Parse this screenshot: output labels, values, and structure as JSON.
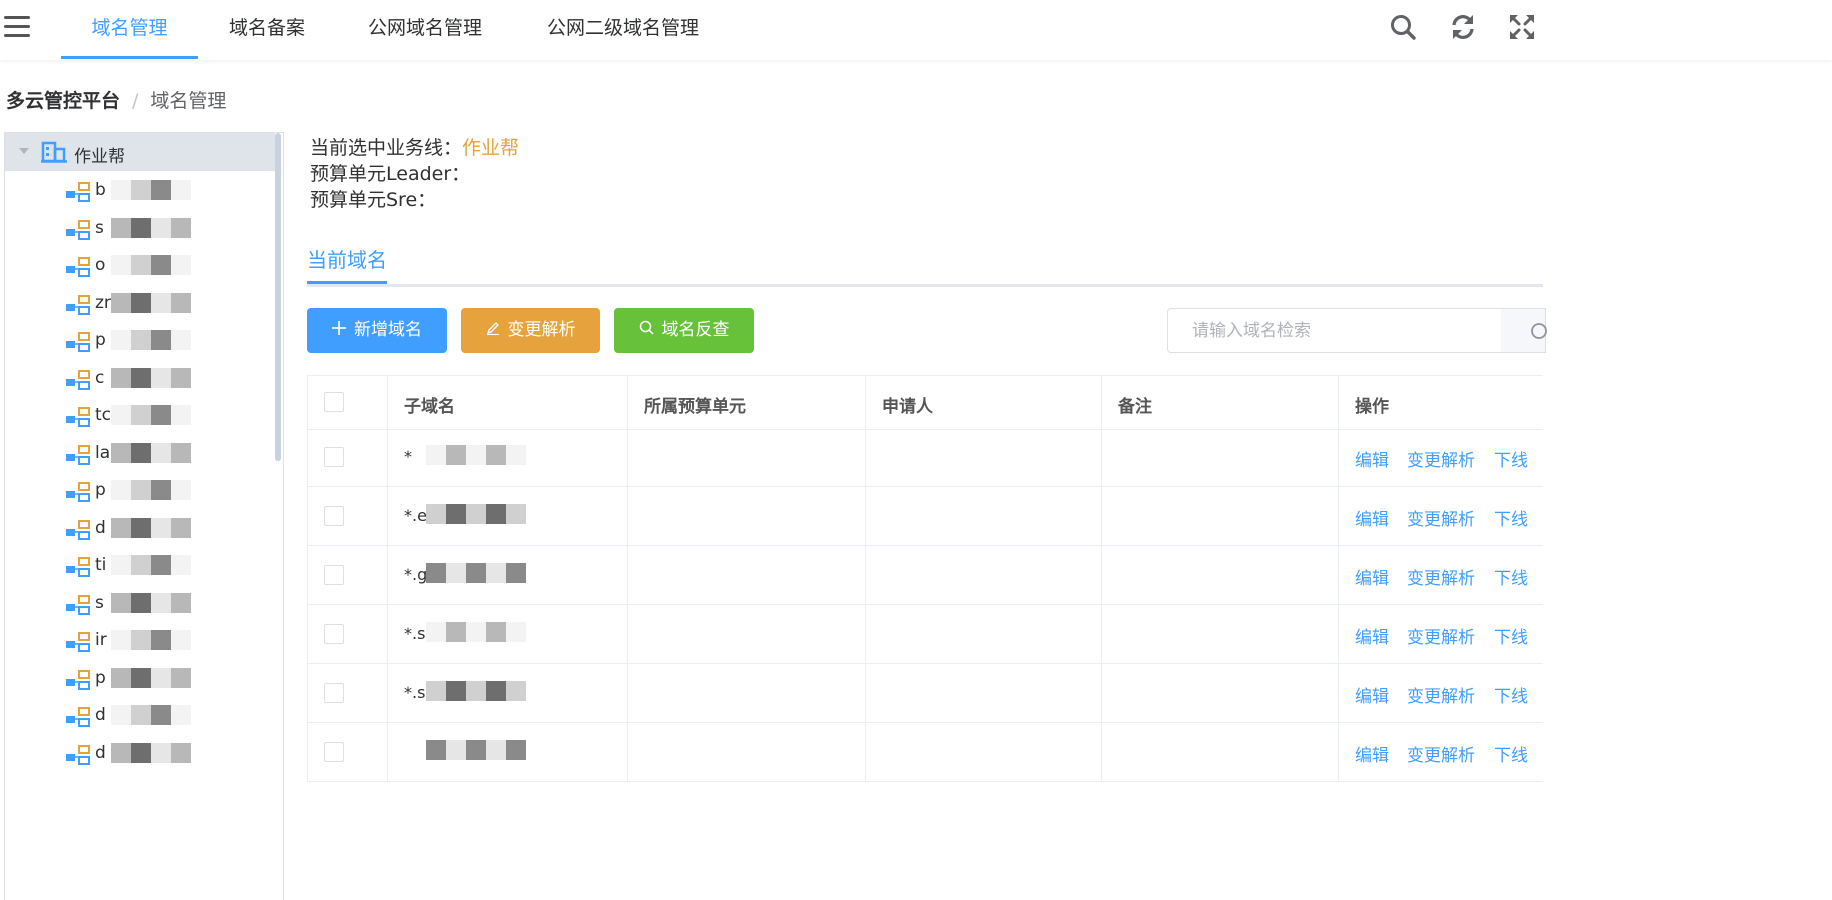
{
  "topnav": {
    "tabs": [
      "域名管理",
      "域名备案",
      "公网域名管理",
      "公网二级域名管理"
    ],
    "active_tab": "域名管理",
    "icons": [
      "search-icon",
      "refresh-icon",
      "fullscreen-icon"
    ]
  },
  "breadcrumb": {
    "root": "多云管控平台",
    "separator": "/",
    "current": "域名管理"
  },
  "tree": {
    "root_label": "作业帮",
    "nodes": [
      "b",
      "s",
      "o",
      "zr",
      "p",
      "c",
      "tc",
      "la",
      "p",
      "d",
      "ti",
      "s",
      "ir",
      "p",
      "d",
      "d"
    ]
  },
  "info": {
    "business_line_label": "当前选中业务线：",
    "business_line_value": "作业帮",
    "leader_label": "预算单元Leader：",
    "sre_label": "预算单元Sre："
  },
  "section": {
    "tab_label": "当前域名"
  },
  "toolbar": {
    "add_label": "新增域名",
    "change_label": "变更解析",
    "reverse_label": "域名反查",
    "search_placeholder": "请输入域名检索"
  },
  "table": {
    "headers": [
      "子域名",
      "所属预算单元",
      "申请人",
      "备注",
      "操作"
    ],
    "rows": [
      {
        "subdomain": "*"
      },
      {
        "subdomain": "*.e"
      },
      {
        "subdomain": "*.g"
      },
      {
        "subdomain": "*.s"
      },
      {
        "subdomain": "*.s"
      },
      {
        "subdomain": ""
      }
    ],
    "ops": {
      "edit": "编辑",
      "change": "变更解析",
      "offline": "下线"
    }
  },
  "colors": {
    "primary": "#409eff",
    "warning": "#e6a23c",
    "success": "#67c23a"
  }
}
